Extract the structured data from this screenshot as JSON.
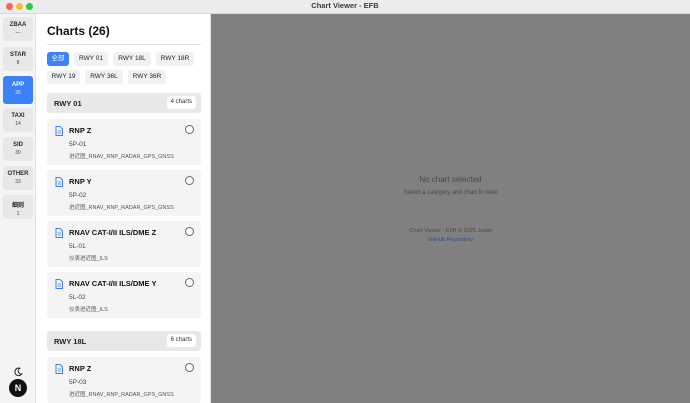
{
  "window": {
    "title": "Chart Viewer - EFB"
  },
  "rail": {
    "items": [
      {
        "label": "ZBAA",
        "count": "—"
      },
      {
        "label": "STAR",
        "count": "8"
      },
      {
        "label": "APP",
        "count": "26"
      },
      {
        "label": "TAXI",
        "count": "14"
      },
      {
        "label": "SID",
        "count": "30"
      },
      {
        "label": "OTHER",
        "count": "33"
      },
      {
        "label": "细则",
        "count": "1"
      }
    ],
    "avatar_letter": "N",
    "colors": {
      "accent": "#3b82f6",
      "rail_bg": "#f4f4f5"
    },
    "icons": {
      "theme": "moon-icon"
    }
  },
  "panel": {
    "title": "Charts (26)",
    "filters": [
      "全部",
      "RWY 01",
      "RWY 18L",
      "RWY 18R",
      "RWY 19",
      "RWY 36L",
      "RWY 36R"
    ],
    "groups": [
      {
        "title": "RWY 01",
        "count": "4 charts",
        "charts": [
          {
            "name": "RNP Z",
            "code": "5P-01",
            "type": "进近图_RNAV_RNP_RADAR_GPS_GNSS"
          },
          {
            "name": "RNP Y",
            "code": "5P-02",
            "type": "进近图_RNAV_RNP_RADAR_GPS_GNSS"
          },
          {
            "name": "RNAV CAT-I/II ILS/DME Z",
            "code": "5L-01",
            "type": "仪表进近图_ILS"
          },
          {
            "name": "RNAV CAT-I/II ILS/DME Y",
            "code": "5L-02",
            "type": "仪表进近图_ILS"
          }
        ]
      },
      {
        "title": "RWY 18L",
        "count": "6 charts",
        "charts": [
          {
            "name": "RNP Z",
            "code": "5P-03",
            "type": "进近图_RNAV_RNP_RADAR_GPS_GNSS"
          }
        ]
      }
    ]
  },
  "main": {
    "empty_title": "No chart selected",
    "empty_subtitle": "Select a category and chart to view",
    "footer_copyright": "Chart Viewer - EFB © 2025 Justin",
    "footer_link": "GitHub Repository",
    "colors": {
      "backdrop": "#808080"
    }
  }
}
